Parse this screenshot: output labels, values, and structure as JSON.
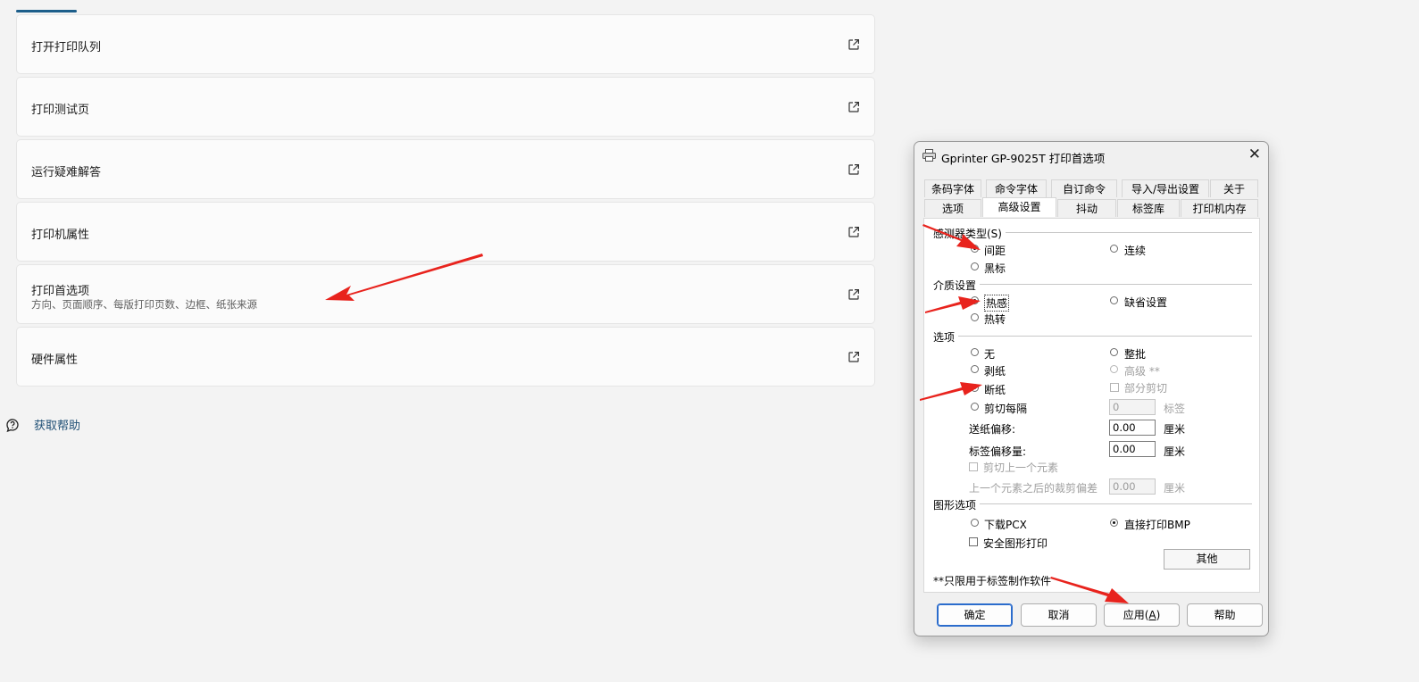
{
  "settings": {
    "rows": [
      {
        "title": "打开打印队列"
      },
      {
        "title": "打印测试页"
      },
      {
        "title": "运行疑难解答"
      },
      {
        "title": "打印机属性"
      },
      {
        "title": "打印首选项",
        "subtitle": "方向、页面顺序、每版打印页数、边框、纸张来源"
      },
      {
        "title": "硬件属性"
      }
    ],
    "help_link": "获取帮助"
  },
  "dialog": {
    "title": "Gprinter GP-9025T 打印首选项",
    "tabs_row1": [
      "条码字体",
      "命令字体",
      "自订命令",
      "导入/导出设置",
      "关于"
    ],
    "tabs_row2": [
      "选项",
      "高级设置",
      "抖动",
      "标签库",
      "打印机内存"
    ],
    "active_tab": "高级设置",
    "sensor_group": {
      "label": "感测器类型(S)",
      "options": [
        "间距",
        "连续",
        "黑标"
      ],
      "selected": "间距"
    },
    "media_group": {
      "label": "介质设置",
      "options": [
        "热感",
        "缺省设置",
        "热转"
      ],
      "selected": "热感"
    },
    "options_group": {
      "label": "选项",
      "none": "无",
      "batch": "整批",
      "peel": "剥纸",
      "advanced": "高级 **",
      "cut": "断纸",
      "partial_cut": "部分剪切",
      "cut_every": "剪切每隔",
      "cut_every_value": "0",
      "cut_every_unit": "标签",
      "feed_offset_label": "送纸偏移:",
      "feed_offset_value": "0.00",
      "feed_offset_unit": "厘米",
      "label_offset_label": "标签偏移量:",
      "label_offset_value": "0.00",
      "label_offset_unit": "厘米",
      "cut_prev": "剪切上一个元素",
      "cut_prev_offset_label": "上一个元素之后的裁剪偏差",
      "cut_prev_offset_value": "0.00",
      "cut_prev_offset_unit": "厘米",
      "selected": "断纸"
    },
    "graphics_group": {
      "label": "图形选项",
      "download_pcx": "下载PCX",
      "direct_bmp": "直接打印BMP",
      "secure_print": "安全图形打印",
      "other_button": "其他",
      "selected": "直接打印BMP"
    },
    "footnote": "**只限用于标签制作软件",
    "buttons": {
      "ok": "确定",
      "cancel": "取消",
      "apply_prefix": "应用(",
      "apply_key": "A",
      "apply_suffix": ")",
      "help": "帮助"
    }
  },
  "colors": {
    "accent": "#1c5e8a",
    "annotation_arrow": "#e8231d",
    "primary_button_border": "#2b6ccc"
  }
}
